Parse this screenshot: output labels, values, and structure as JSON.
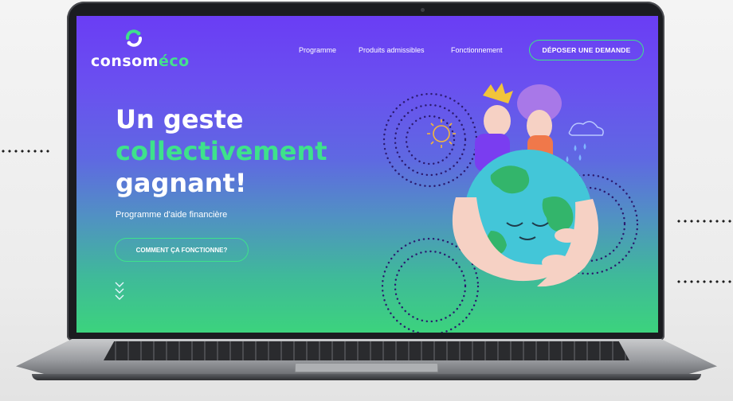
{
  "site": {
    "logo": {
      "text_main": "consom",
      "text_accent": "éco",
      "icon": "recycle-swirl-icon"
    },
    "nav": {
      "items": [
        {
          "label": "Programme"
        },
        {
          "label": "Produits admissibles"
        },
        {
          "label": "Fonctionnement"
        }
      ],
      "cta_label": "DÉPOSER UNE DEMANDE"
    },
    "hero": {
      "line1": "Un geste",
      "line2": "collectivement",
      "line3": "gagnant!",
      "subtitle": "Programme d'aide financière",
      "button_label": "COMMENT ÇA FONCTIONNE?",
      "scroll_icon": "triple-chevron-down-icon",
      "illustration_icon": "people-hugging-earth-icon"
    }
  },
  "colors": {
    "accent_green": "#3ee28b",
    "gradient_top": "#6a3df4",
    "gradient_bottom": "#3cd37d"
  }
}
